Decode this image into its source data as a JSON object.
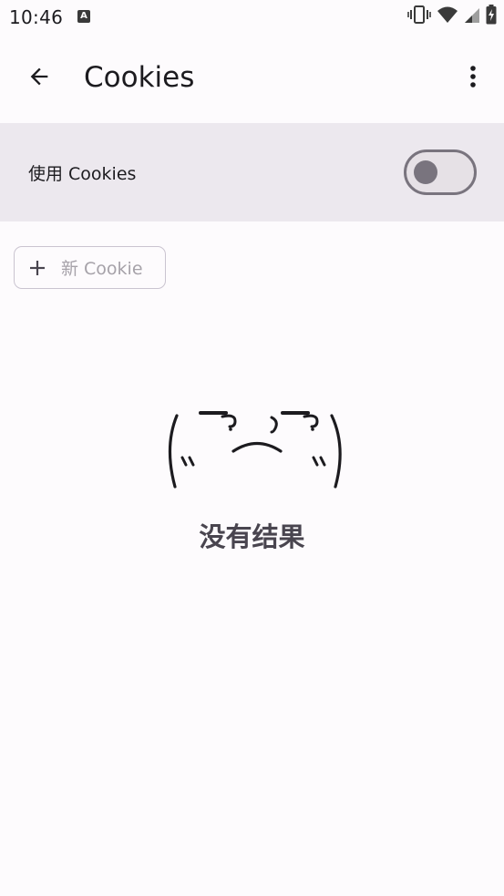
{
  "status_bar": {
    "time": "10:46",
    "app_icon_letter": "A",
    "icons": [
      "vibrate-icon",
      "wifi-icon",
      "cellular-signal-icon",
      "battery-charging-icon"
    ]
  },
  "app_bar": {
    "title": "Cookies",
    "back_icon": "arrow-back-icon",
    "more_icon": "more-vert-icon"
  },
  "toggle_row": {
    "label": "使用 Cookies",
    "enabled": false
  },
  "new_cookie_button": {
    "label": "新 Cookie",
    "icon": "plus-icon",
    "disabled": true
  },
  "empty_state": {
    "text": "没有结果"
  },
  "colors": {
    "background": "#fdfbfd",
    "toggle_row_bg": "#ece8ee",
    "switch_outline": "#79747e",
    "switch_track": "#e6e1e6",
    "disabled_text": "#a6a2a9",
    "empty_text": "#49454f"
  }
}
